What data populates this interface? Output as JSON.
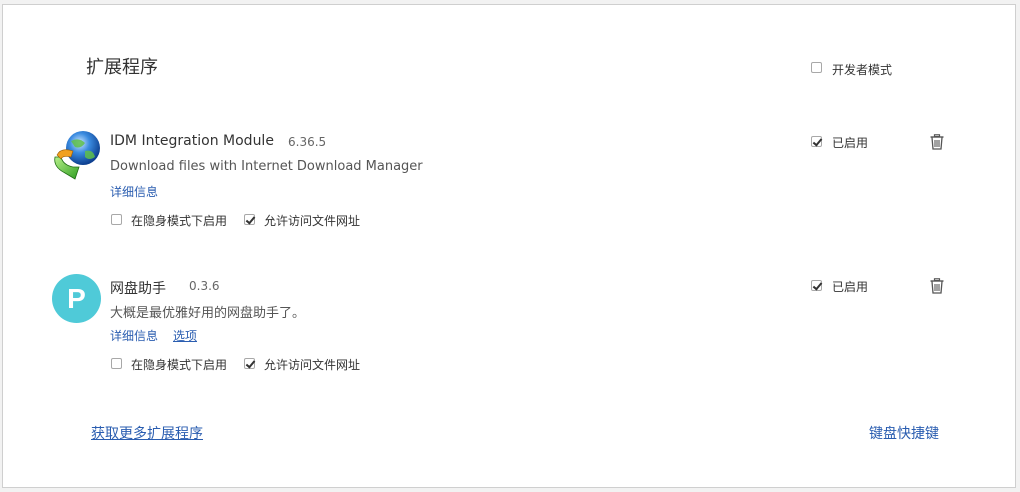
{
  "page": {
    "title": "扩展程序",
    "developer_mode_label": "开发者模式",
    "developer_mode_checked": false
  },
  "extensions": [
    {
      "name": "IDM Integration Module",
      "version": "6.36.5",
      "description": "Download files with Internet Download Manager",
      "details_label": "详细信息",
      "enabled_label": "已启用",
      "enabled": true,
      "incognito_label": "在隐身模式下启用",
      "incognito": false,
      "file_access_label": "允许访问文件网址",
      "file_access": true,
      "icon": "idm-globe-arrow-icon"
    },
    {
      "name": "网盘助手",
      "version": "0.3.6",
      "description": "大概是最优雅好用的网盘助手了。",
      "details_label": "详细信息",
      "options_label": "选项",
      "enabled_label": "已启用",
      "enabled": true,
      "incognito_label": "在隐身模式下启用",
      "incognito": false,
      "file_access_label": "允许访问文件网址",
      "file_access": true,
      "icon_letter": "P",
      "icon_color": "#4fcad8"
    }
  ],
  "footer": {
    "get_more_label": "获取更多扩展程序",
    "keyboard_shortcuts_label": "键盘快捷键"
  },
  "colors": {
    "link": "#2a5db0",
    "text": "#333333"
  }
}
